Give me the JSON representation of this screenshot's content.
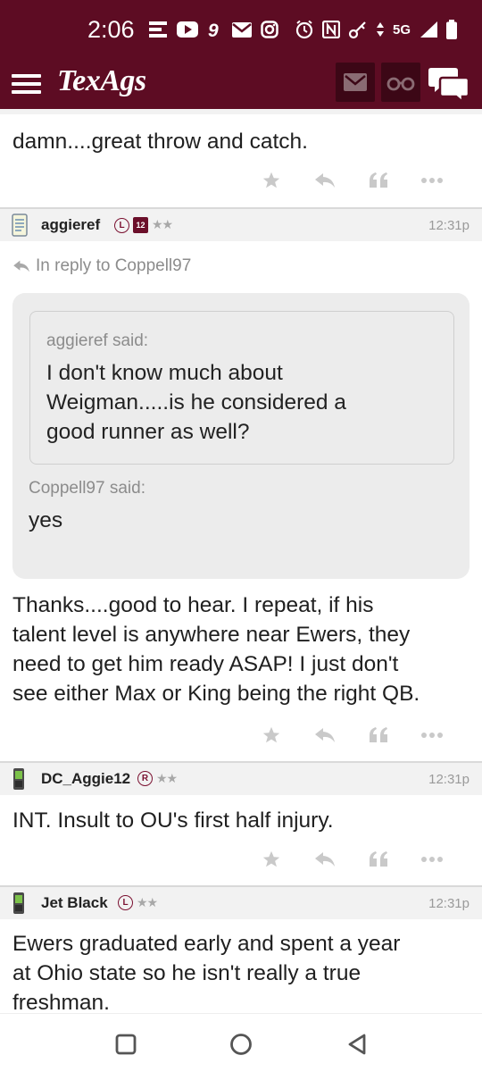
{
  "status_bar": {
    "time": "2:06",
    "network": "5G",
    "left_icons": [
      "menu-lines-icon",
      "youtube-icon",
      "nine-icon",
      "mail-icon",
      "instagram-icon"
    ],
    "right_icons": [
      "alarm-icon",
      "nfc-icon",
      "key-icon",
      "data-arrows-icon",
      "signal-icon",
      "battery-icon"
    ]
  },
  "header": {
    "logo": "TexAgs",
    "icons": [
      "menu-icon",
      "mail-icon",
      "binoculars-icon",
      "chat-icon"
    ]
  },
  "posts": [
    {
      "body": "damn....great throw and catch."
    },
    {
      "username": "aggieref",
      "badges": [
        "L",
        "12"
      ],
      "stars": "★★",
      "time": "12:31p",
      "reply_to": "In reply to Coppell97",
      "quote_outer_said": "Coppell97 said:",
      "quote_outer_text": "yes",
      "quote_inner_said": "aggieref said:",
      "quote_inner_lines": [
        "I don't know much about",
        "Weigman.....is he considered a",
        "good runner as well?"
      ],
      "body_lines": [
        "Thanks....good to hear. I repeat, if his",
        "talent level is anywhere near Ewers, they",
        "need to get him ready ASAP! I just don't",
        "see either Max or King being the right QB."
      ]
    },
    {
      "username": "DC_Aggie12",
      "badges": [
        "R"
      ],
      "stars": "★★",
      "time": "12:31p",
      "body": "INT. Insult to OU's first half injury."
    },
    {
      "username": "Jet Black",
      "badges": [
        "L"
      ],
      "stars": "★★",
      "time": "12:31p",
      "body_lines": [
        "Ewers graduated early and spent a year",
        "at Ohio state so he isn't really a true",
        "freshman."
      ]
    }
  ],
  "post_actions": [
    "star-icon",
    "reply-icon",
    "quote-icon",
    "more-icon"
  ],
  "colors": {
    "brand": "#5d0c23",
    "brand_dark": "#3c0716",
    "post_header_bg": "#f2f2f2",
    "quote_bg": "#ececec",
    "muted_text": "#8c8c8c"
  },
  "nav_bar": [
    "recents-icon",
    "home-icon",
    "back-icon"
  ]
}
